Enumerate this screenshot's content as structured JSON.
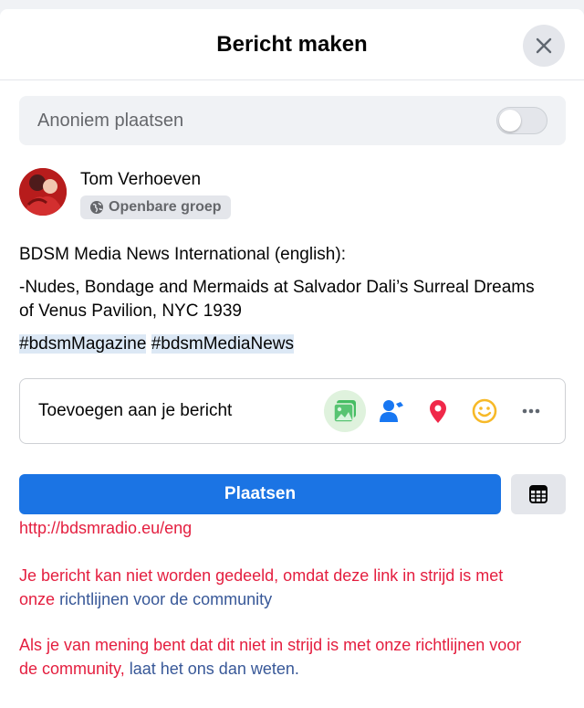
{
  "dialog": {
    "title": "Bericht maken"
  },
  "anonymous": {
    "label": "Anoniem plaatsen",
    "enabled": false
  },
  "user": {
    "name": "Tom Verhoeven",
    "privacy": "Openbare groep"
  },
  "post": {
    "line1": "BDSM Media News International (english):",
    "line2a": "-Nudes, Bondage and Mermaids at Salvador Dali’s Surreal Dreams",
    "line2b": "of Venus Pavilion, NYC 1939",
    "hashtag1": "#bdsmMagazine",
    "hashtag2": "#bdsmMediaNews"
  },
  "add_to_post": {
    "label": "Toevoegen aan je bericht",
    "icons": [
      "photo-video-icon",
      "tag-people-icon",
      "location-pin-icon",
      "feeling-smiley-icon",
      "more-icon"
    ]
  },
  "actions": {
    "post_label": "Plaatsen"
  },
  "errors": {
    "link": "http://bdsmradio.eu/eng",
    "msg1_a": "Je bericht kan niet worden gedeeld, omdat deze link in strijd is met",
    "msg1_b": "onze",
    "msg1_link": "richtlijnen voor de community",
    "msg2_a": "Als je van mening bent dat dit niet in strijd is met onze richtlijnen voor",
    "msg2_b": "de community,",
    "msg2_link": "laat het ons dan weten",
    "msg2_end": "."
  },
  "colors": {
    "primary": "#1b74e4",
    "error": "#e41e3f",
    "link": "#385898"
  }
}
